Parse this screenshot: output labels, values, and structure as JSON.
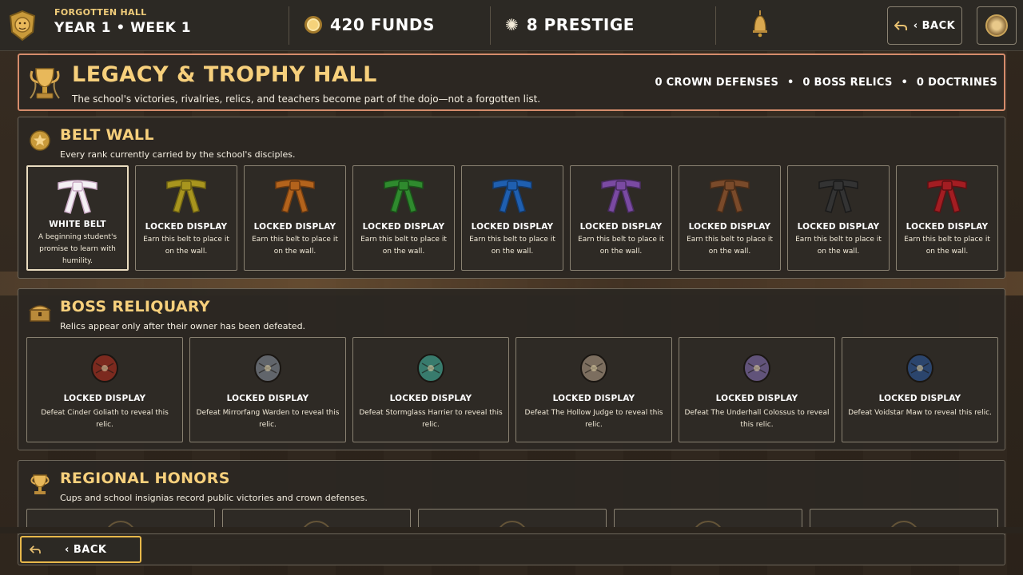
{
  "topbar": {
    "school_name": "FORGOTTEN HALL",
    "date_label": "YEAR 1  •  WEEK 1",
    "funds_label": "420 FUNDS",
    "prestige_label": "8 PRESTIGE",
    "back_label": "‹ BACK",
    "icons": [
      "lion-crest-icon",
      "coin-icon",
      "burst-icon",
      "bell-icon",
      "back-arrow-icon",
      "avatar-icon"
    ]
  },
  "hall": {
    "title": "LEGACY & TROPHY HALL",
    "subtitle": "The school's victories, rivalries, relics, and teachers become part of the dojo—not a forgotten list.",
    "stats": [
      "0 CROWN DEFENSES",
      "0 BOSS RELICS",
      "0 DOCTRINES"
    ],
    "separator": "•"
  },
  "belt_wall": {
    "title": "BELT WALL",
    "subtitle": "Every rank currently carried by the school's disciples.",
    "belts": [
      {
        "title": "WHITE BELT",
        "desc": "A beginning student's promise to learn with humility.",
        "color": "#f4f0f4",
        "edge": "#c9a9c4",
        "active": true
      },
      {
        "title": "LOCKED DISPLAY",
        "desc": "Earn this belt to place it on the wall.",
        "color": "#a8951e",
        "edge": "#6e6212",
        "active": false
      },
      {
        "title": "LOCKED DISPLAY",
        "desc": "Earn this belt to place it on the wall.",
        "color": "#b3631c",
        "edge": "#6f3b10",
        "active": false
      },
      {
        "title": "LOCKED DISPLAY",
        "desc": "Earn this belt to place it on the wall.",
        "color": "#2f8a2e",
        "edge": "#1a5219",
        "active": false
      },
      {
        "title": "LOCKED DISPLAY",
        "desc": "Earn this belt to place it on the wall.",
        "color": "#1f5fb0",
        "edge": "#133a6c",
        "active": false
      },
      {
        "title": "LOCKED DISPLAY",
        "desc": "Earn this belt to place it on the wall.",
        "color": "#7a4aa2",
        "edge": "#4a2c63",
        "active": false
      },
      {
        "title": "LOCKED DISPLAY",
        "desc": "Earn this belt to place it on the wall.",
        "color": "#7a4a2a",
        "edge": "#4a2c18",
        "active": false
      },
      {
        "title": "LOCKED DISPLAY",
        "desc": "Earn this belt to place it on the wall.",
        "color": "#333333",
        "edge": "#1a1a1a",
        "active": false
      },
      {
        "title": "LOCKED DISPLAY",
        "desc": "Earn this belt to place it on the wall.",
        "color": "#a31d22",
        "edge": "#5e1013",
        "active": false
      }
    ]
  },
  "boss_reliquary": {
    "title": "BOSS RELIQUARY",
    "subtitle": "Relics appear only after their owner has been defeated.",
    "relics": [
      {
        "title": "LOCKED DISPLAY",
        "desc": "Defeat Cinder Goliath to reveal this relic.",
        "icon": "cinder-armor-icon",
        "color": "#8a2a1e"
      },
      {
        "title": "LOCKED DISPLAY",
        "desc": "Defeat Mirrorfang Warden to reveal this relic.",
        "icon": "mirror-mask-icon",
        "color": "#6a7078"
      },
      {
        "title": "LOCKED DISPLAY",
        "desc": "Defeat Stormglass Harrier to reveal this relic.",
        "icon": "storm-boots-icon",
        "color": "#3a8a7a"
      },
      {
        "title": "LOCKED DISPLAY",
        "desc": "Defeat The Hollow Judge to reveal this relic.",
        "icon": "judge-mask-icon",
        "color": "#8a7a6a"
      },
      {
        "title": "LOCKED DISPLAY",
        "desc": "Defeat The Underhall Colossus to reveal this relic.",
        "icon": "colossus-ring-icon",
        "color": "#6a5a8a"
      },
      {
        "title": "LOCKED DISPLAY",
        "desc": "Defeat Voidstar Maw to reveal this relic.",
        "icon": "void-gauntlets-icon",
        "color": "#2a4a7a"
      }
    ]
  },
  "regional_honors": {
    "title": "REGIONAL HONORS",
    "subtitle": "Cups and school insignias record public victories and crown defenses.",
    "card_count_visible": 5
  },
  "footer": {
    "back_label": "‹  BACK"
  }
}
